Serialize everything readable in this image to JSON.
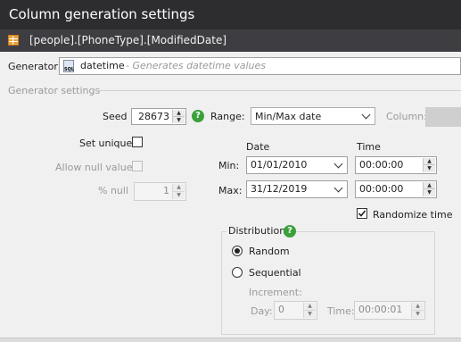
{
  "window": {
    "title": "Column generation settings"
  },
  "column": {
    "path": "[people].[PhoneType].[ModifiedDate]"
  },
  "generator": {
    "label": "Generator:",
    "name": "datetime",
    "description": "- Generates datetime values"
  },
  "settings": {
    "section_label": "Generator settings",
    "seed_label": "Seed",
    "seed_value": "28673",
    "range_label": "Range:",
    "range_value": "Min/Max date",
    "column_label": "Column:",
    "set_unique_label": "Set unique",
    "set_unique_checked": false,
    "allow_null_label": "Allow null values",
    "allow_null_checked": false,
    "percent_null_label": "% null",
    "percent_null_value": "1",
    "date_header": "Date",
    "time_header": "Time",
    "min_label": "Min:",
    "min_date": "01/01/2010",
    "min_time": "00:00:00",
    "max_label": "Max:",
    "max_date": "31/12/2019",
    "max_time": "00:00:00",
    "randomize_time_label": "Randomize time",
    "randomize_time_checked": true
  },
  "distribution": {
    "label": "Distribution",
    "random_label": "Random",
    "sequential_label": "Sequential",
    "selected": "Random",
    "increment_label": "Increment:",
    "day_label": "Day:",
    "day_value": "0",
    "time_label": "Time:",
    "time_value": "00:00:01"
  },
  "colors": {
    "titlebar": "#2d2d30",
    "subbar": "#3e3e42",
    "help": "#3aa03a",
    "background": "#f0f0f0"
  }
}
